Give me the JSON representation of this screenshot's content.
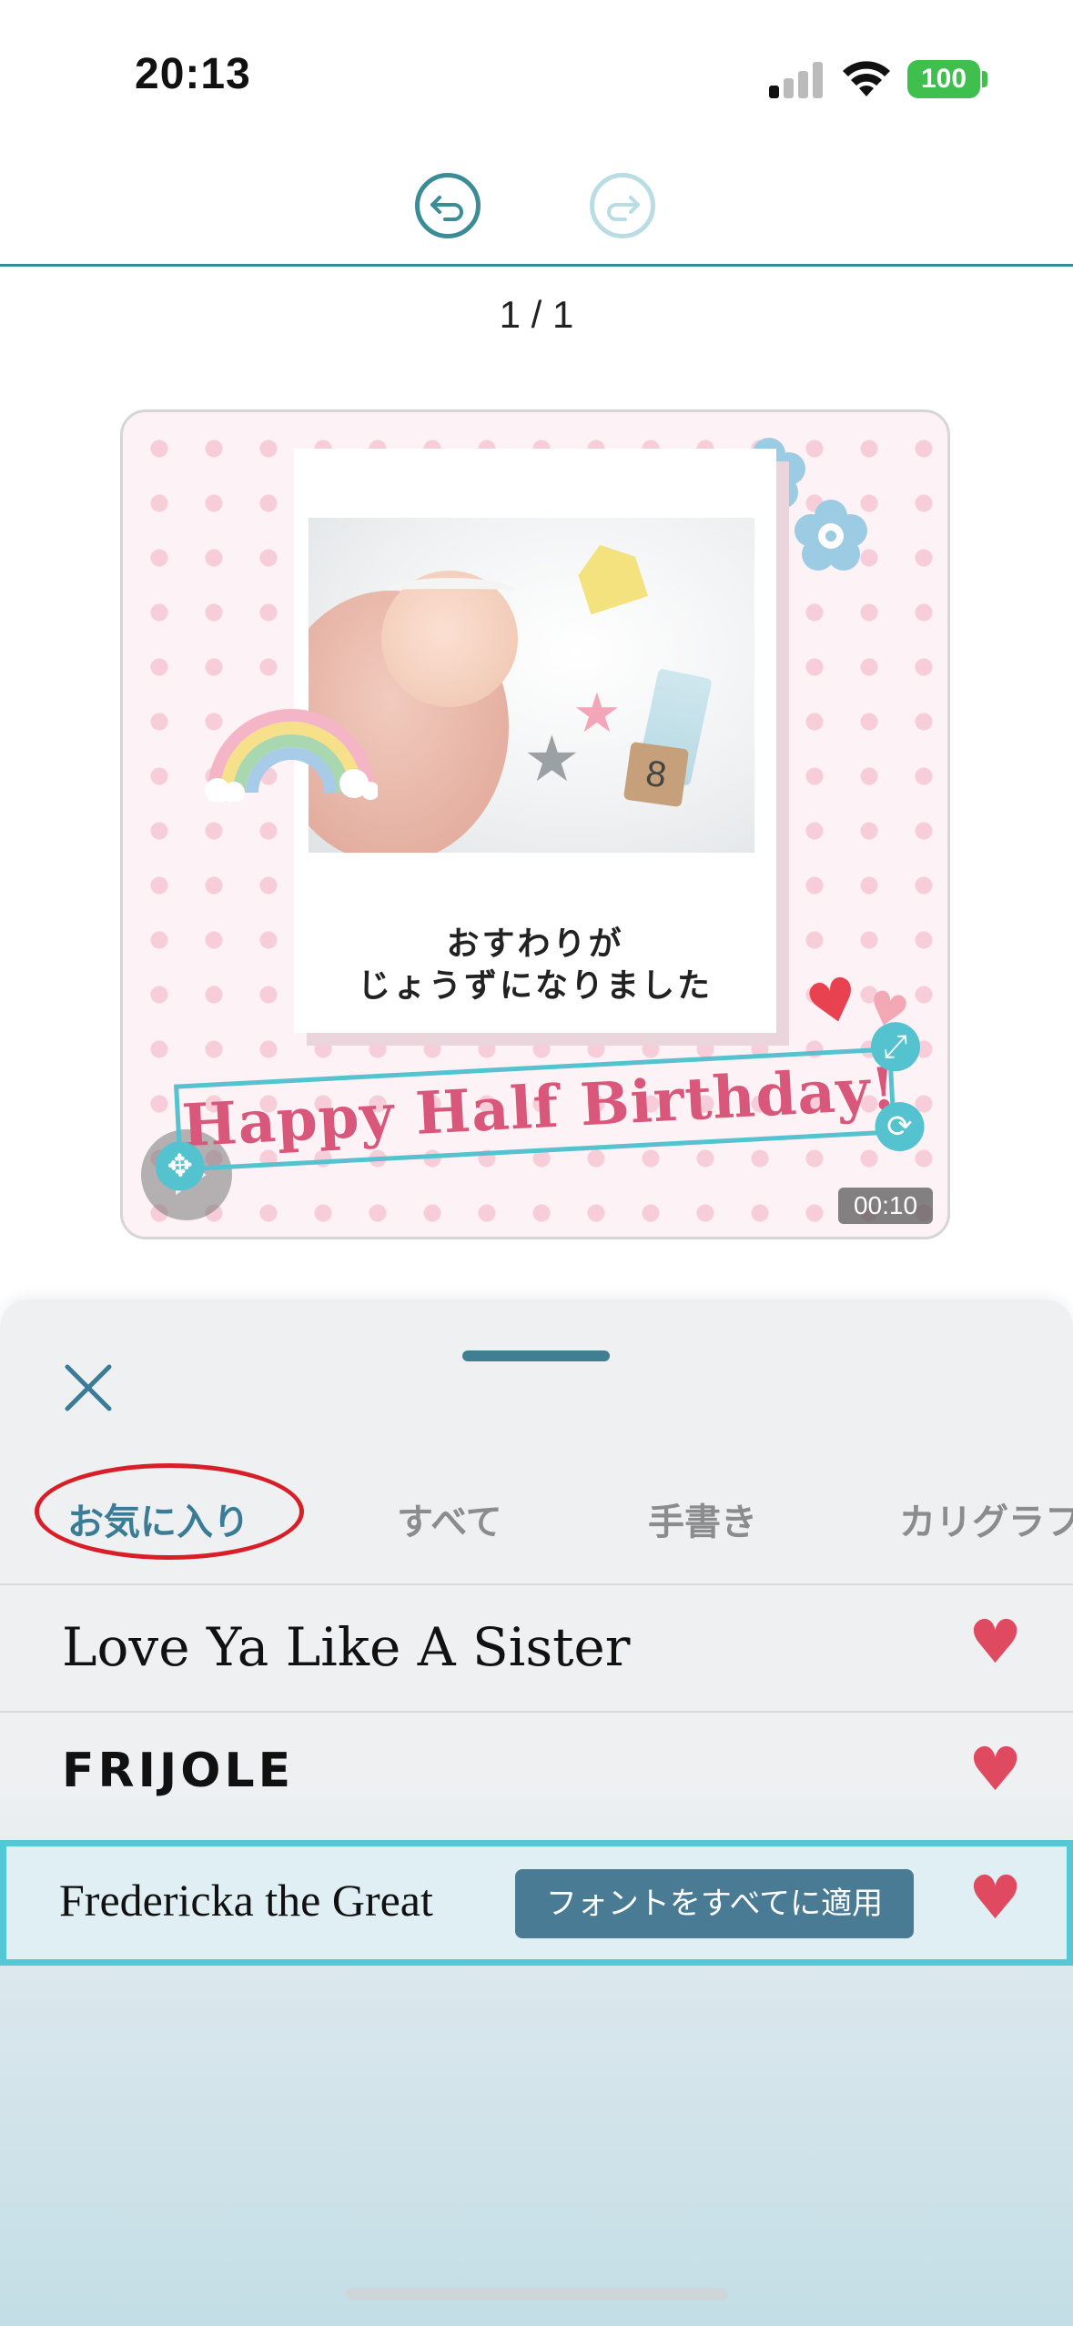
{
  "status_bar": {
    "time": "20:13",
    "battery": "100"
  },
  "page": {
    "counter": "1 / 1"
  },
  "canvas": {
    "caption_line1": "おすわりが",
    "caption_line2": "じょうずになりました",
    "title_text": "Happy Half Birthday!",
    "duration": "00:10",
    "block_number": "8"
  },
  "tabs": [
    "お気に入り",
    "すべて",
    "手書き",
    "カリグラフ"
  ],
  "fonts": [
    {
      "name": "Love Ya Like A Sister",
      "favorite": true
    },
    {
      "name": "FRIJOLE",
      "favorite": true
    },
    {
      "name": "Fredericka the Great",
      "favorite": true,
      "selected": true
    }
  ],
  "apply_button": "フォントをすべてに適用",
  "colors": {
    "accent": "#3a8c97",
    "selection": "#55c2cf",
    "heart": "#e04a60",
    "annotation_circle": "#d81f28"
  }
}
